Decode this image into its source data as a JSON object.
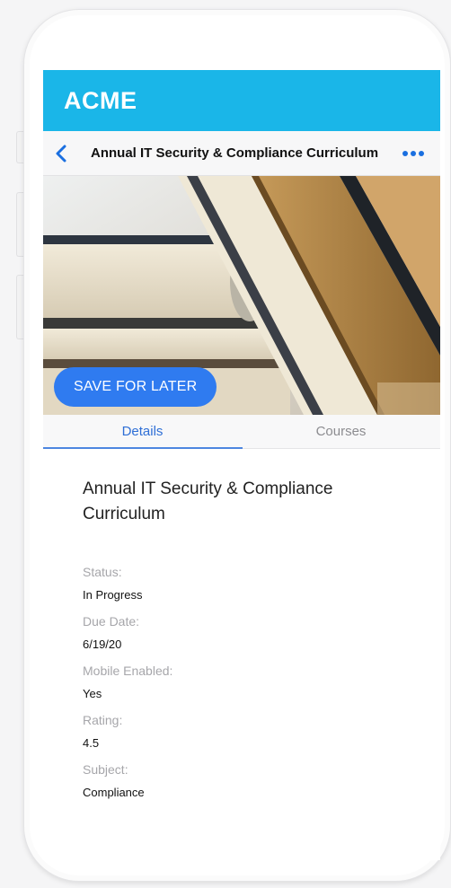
{
  "brand": {
    "logo_text": "ACME",
    "color": "#1ab6e8"
  },
  "nav": {
    "back_icon": "chevron-left-icon",
    "title": "Annual IT Security & Compliance Curriculum",
    "more_icon": "ellipsis-horizontal-icon",
    "accent_color": "#1a6fe0"
  },
  "hero": {
    "image_subject": "stacked and leaning books",
    "save_button_label": "SAVE FOR LATER",
    "save_button_color": "#2f7bf0"
  },
  "tabs": [
    {
      "label": "Details",
      "active": true
    },
    {
      "label": "Courses",
      "active": false
    }
  ],
  "details": {
    "title": "Annual IT Security & Compliance Curriculum",
    "fields": [
      {
        "label": "Status:",
        "value": "In Progress"
      },
      {
        "label": "Due Date:",
        "value": "6/19/20"
      },
      {
        "label": "Mobile Enabled:",
        "value": "Yes"
      },
      {
        "label": "Rating:",
        "value": "4.5"
      },
      {
        "label": "Subject:",
        "value": "Compliance"
      }
    ]
  }
}
